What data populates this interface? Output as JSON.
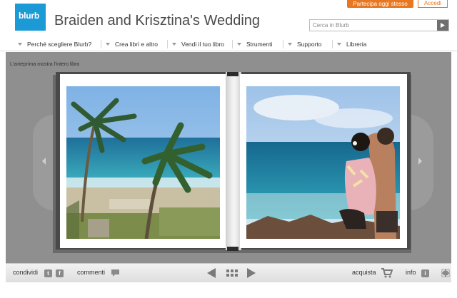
{
  "header": {
    "logo_text": "blurb",
    "title": "Braiden and Krisztina's Wedding",
    "cta_label": "Partecipa oggi stesso",
    "login_label": "Accedi",
    "search_placeholder": "Cerca in Blurb"
  },
  "nav": {
    "items": [
      {
        "label": "Perché scegliere Blurb?"
      },
      {
        "label": "Crea libri e altro"
      },
      {
        "label": "Vendi il tuo libro"
      },
      {
        "label": "Strumenti"
      },
      {
        "label": "Supporto"
      },
      {
        "label": "Libreria"
      }
    ]
  },
  "preview": {
    "note": "L'anteprima mostra l'intero libro"
  },
  "toolbar": {
    "share_label": "condividi",
    "twitter_icon_text": "t",
    "facebook_icon_text": "f",
    "comments_label": "commenti",
    "buy_label": "acquista",
    "info_label": "info",
    "info_icon_text": "i"
  },
  "colors": {
    "brand_blue": "#1c9ad6",
    "accent_orange": "#e87722",
    "preview_gray": "#8f8f8f"
  }
}
